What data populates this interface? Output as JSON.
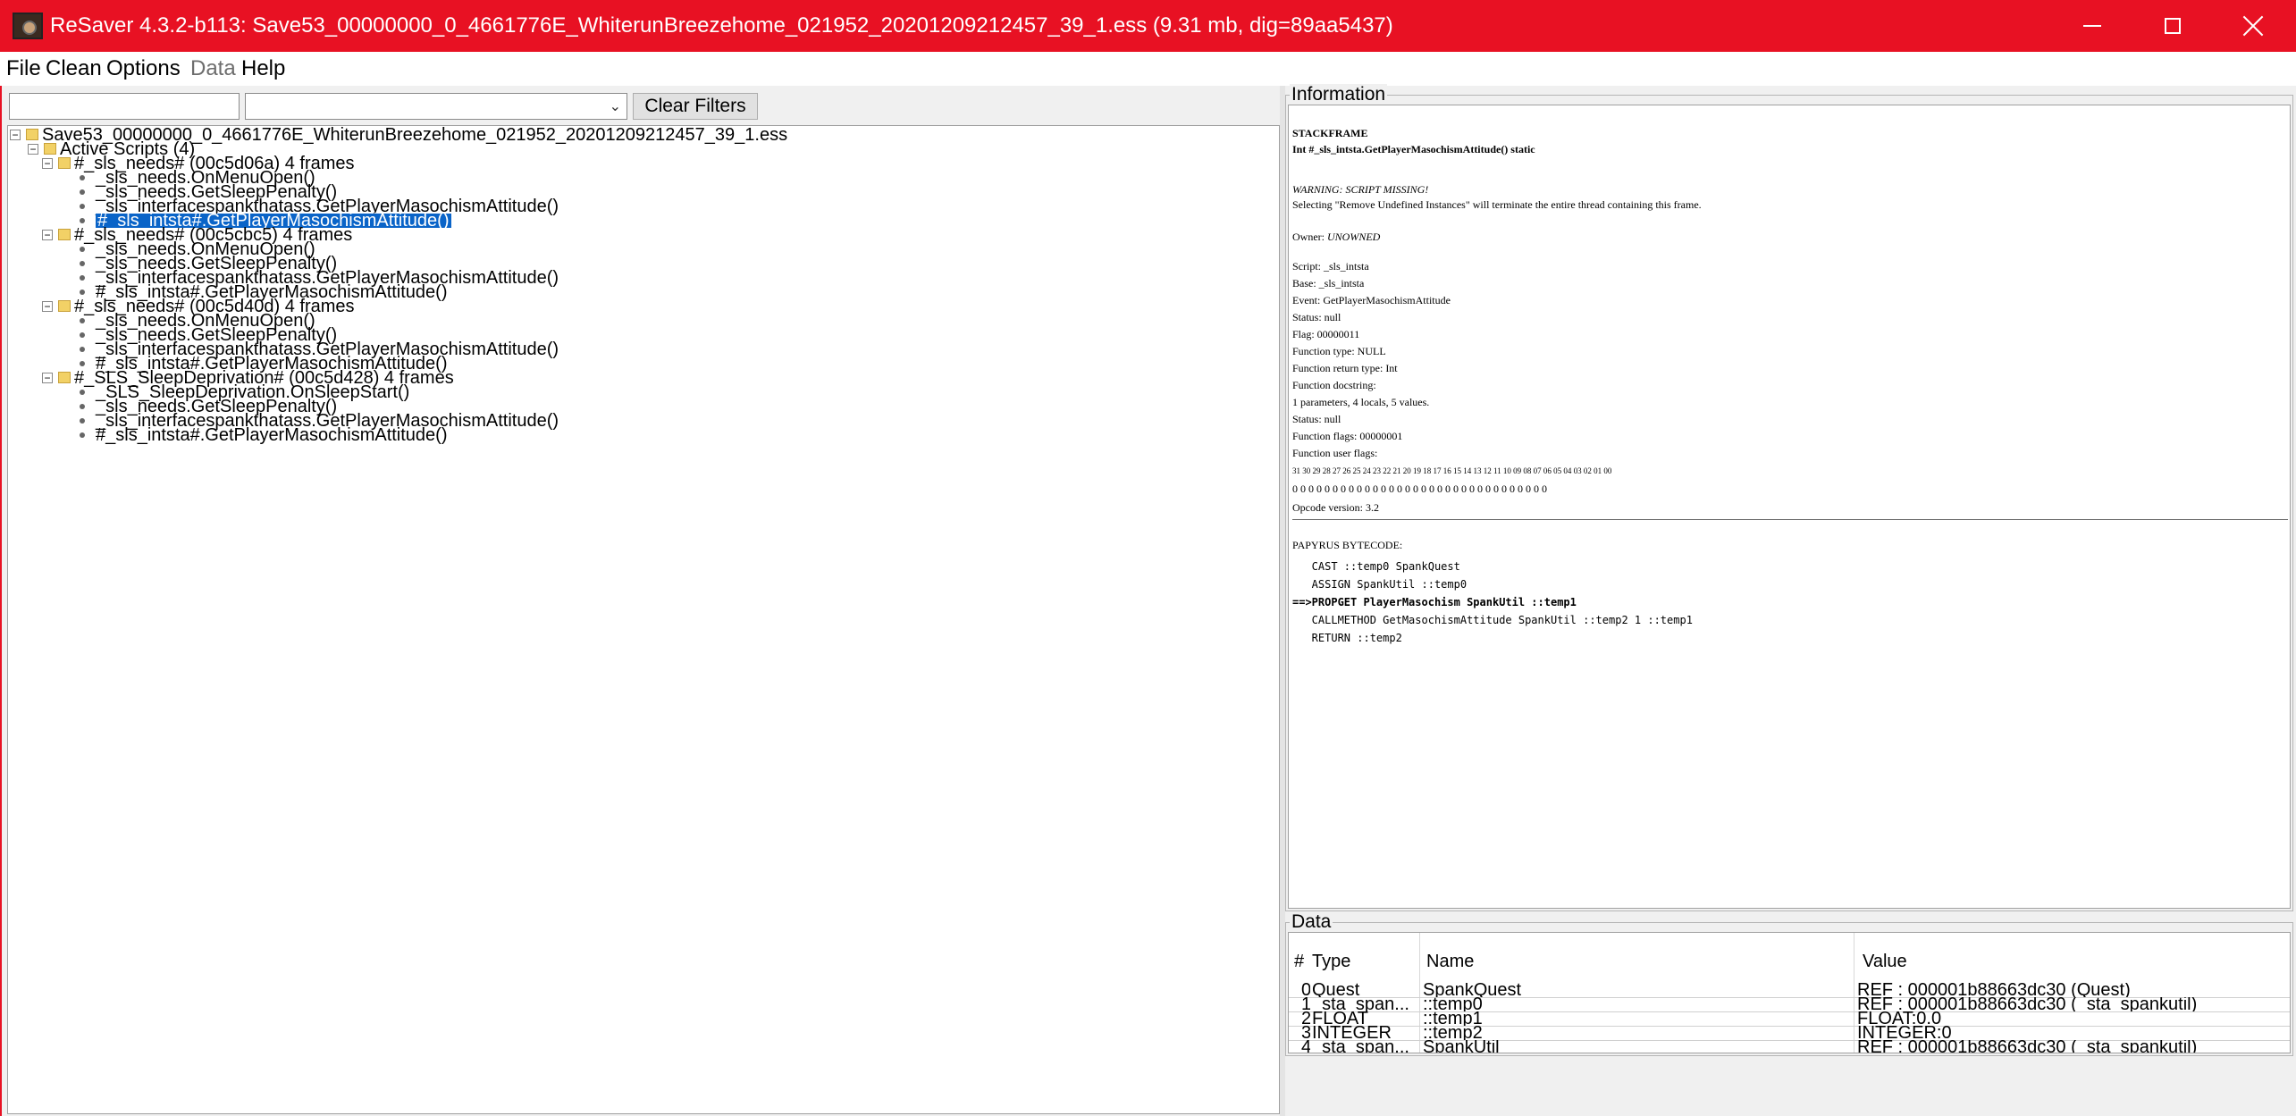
{
  "titlebar": {
    "title": "ReSaver 4.3.2-b113: Save53_00000000_0_4661776E_WhiterunBreezehome_021952_20201209212457_39_1.ess (9.31 mb, dig=89aa5437)"
  },
  "menu": {
    "file": "File",
    "clean": "Clean",
    "options": "Options",
    "data": "Data",
    "help": "Help"
  },
  "filter": {
    "clear_label": "Clear Filters"
  },
  "tree": {
    "root": "Save53_00000000_0_4661776E_WhiterunBreezehome_021952_20201209212457_39_1.ess",
    "active_scripts": "Active Scripts (4)",
    "threads": [
      {
        "label": "#_sls_needs# (00c5d06a) 4 frames",
        "frames": [
          "_sls_needs.OnMenuOpen()",
          "_sls_needs.GetSleepPenalty()",
          "_sls_interfacespankthatass.GetPlayerMasochismAttitude()",
          "#_sls_intsta#.GetPlayerMasochismAttitude()"
        ]
      },
      {
        "label": "#_sls_needs# (00c5cbc5) 4 frames",
        "frames": [
          "_sls_needs.OnMenuOpen()",
          "_sls_needs.GetSleepPenalty()",
          "_sls_interfacespankthatass.GetPlayerMasochismAttitude()",
          "#_sls_intsta#.GetPlayerMasochismAttitude()"
        ]
      },
      {
        "label": "#_sls_needs# (00c5d40d) 4 frames",
        "frames": [
          "_sls_needs.OnMenuOpen()",
          "_sls_needs.GetSleepPenalty()",
          "_sls_interfacespankthatass.GetPlayerMasochismAttitude()",
          "#_sls_intsta#.GetPlayerMasochismAttitude()"
        ]
      },
      {
        "label": "#_SLS_SleepDeprivation# (00c5d428) 4 frames",
        "frames": [
          "_SLS_SleepDeprivation.OnSleepStart()",
          "_sls_needs.GetSleepPenalty()",
          "_sls_interfacespankthatass.GetPlayerMasochismAttitude()",
          "#_sls_intsta#.GetPlayerMasochismAttitude()"
        ]
      }
    ]
  },
  "info": {
    "group_title": "Information",
    "heading": "STACKFRAME",
    "signature": "Int #_sls_intsta.GetPlayerMasochismAttitude() static",
    "warning": "WARNING: SCRIPT MISSING!",
    "warning_detail": "Selecting \"Remove Undefined Instances\" will terminate the entire thread containing this frame.",
    "owner_label": "Owner: ",
    "owner_value": "UNOWNED",
    "details": [
      "Script: _sls_intsta",
      "Base: _sls_intsta",
      "Event: GetPlayerMasochismAttitude",
      "Status: null",
      "Flag: 00000011",
      "Function type: NULL",
      "Function return type: Int",
      "Function docstring:",
      "1 parameters, 4 locals, 5 values.",
      "Status: null",
      "Function flags: 00000001",
      "Function user flags:"
    ],
    "bit_indices": "31 30 29 28 27 26 25 24 23 22 21 20 19 18 17 16 15 14 13 12 11 10 09 08 07 06 05 04 03 02 01 00",
    "bit_values": "0 0 0 0 0 0 0 0 0 0 0 0 0 0 0 0 0 0 0 0 0 0 0 0 0 0 0 0 0 0 0 0",
    "opcode_version": "Opcode version: 3.2",
    "bytecode_heading": "PAPYRUS BYTECODE:",
    "bytecode": [
      "   CAST ::temp0 SpankQuest",
      "   ASSIGN SpankUtil ::temp0",
      "==>PROPGET PlayerMasochism SpankUtil ::temp1",
      "   CALLMETHOD GetMasochismAttitude SpankUtil ::temp2 1 ::temp1",
      "   RETURN ::temp2"
    ]
  },
  "data_table": {
    "group_title": "Data",
    "headers": {
      "index": "#",
      "type": "Type",
      "name": "Name",
      "value": "Value"
    },
    "rows": [
      {
        "index": "0",
        "type": "Quest",
        "name": "SpankQuest",
        "value": "REF : 000001b88663dc30 (Quest)"
      },
      {
        "index": "1",
        "type": "_sta_span...",
        "name": "::temp0",
        "value": "REF : 000001b88663dc30 (_sta_spankutil)"
      },
      {
        "index": "2",
        "type": "FLOAT",
        "name": "::temp1",
        "value": "FLOAT:0.0"
      },
      {
        "index": "3",
        "type": "INTEGER",
        "name": "::temp2",
        "value": "INTEGER:0"
      },
      {
        "index": "4",
        "type": "_sta_span...",
        "name": "SpankUtil",
        "value": "REF : 000001b88663dc30 (_sta_spankutil)"
      }
    ]
  }
}
